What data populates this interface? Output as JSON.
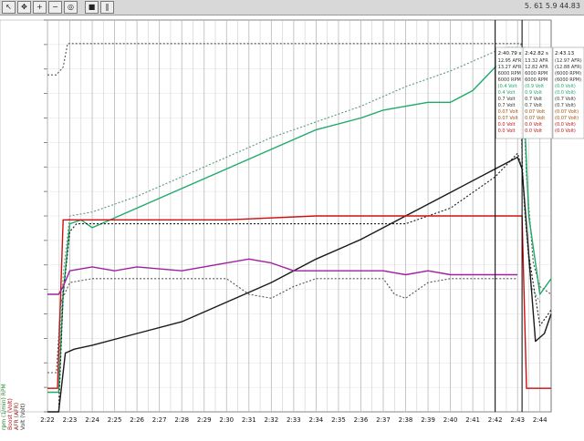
{
  "toolbar": {
    "buttons": [
      {
        "icon": "cursor-icon",
        "glyph": "↖"
      },
      {
        "icon": "move-icon",
        "glyph": "✥"
      },
      {
        "icon": "zoom-in-icon",
        "glyph": "+"
      },
      {
        "icon": "zoom-out-icon",
        "glyph": "−"
      },
      {
        "icon": "zoom-fit-icon",
        "glyph": "◎"
      },
      {
        "icon": "stop-icon",
        "glyph": "■"
      },
      {
        "icon": "pause-icon",
        "glyph": "‖"
      }
    ],
    "status": "5. 61 5.9 44.83"
  },
  "colors": {
    "background": "#ffffff",
    "grid": "#b8b8b8",
    "cursor": "#000000",
    "afr_solid": "#1faa6a",
    "afr_dotted": "#5a9a7a",
    "rpm_solid": "#1a1a1a",
    "rpm_dotted": "#1a1a1a",
    "boost": "#d01010",
    "knock": "#a020a0",
    "volt_dotted": "#555555",
    "tps": "#555555"
  },
  "chart_data": {
    "type": "line",
    "x_ticks": [
      "2:22",
      "2:23",
      "2:24",
      "2:25",
      "2:26",
      "2:27",
      "2:28",
      "2:29",
      "2:30",
      "2:31",
      "2:32",
      "2:33",
      "2:34",
      "2:35",
      "2:36",
      "2:37",
      "2:38",
      "2:39",
      "2:40",
      "2:41",
      "2:42",
      "2:43",
      "2:44"
    ],
    "xlim": [
      2.22,
      2.445
    ],
    "cursors": [
      2.42,
      2.432
    ],
    "cursor_panels": [
      {
        "time": "2:40.79 s",
        "rows": [
          "12.95 AFR",
          "13.27 AFR",
          "6000 RPM",
          "6000 RPM",
          "(0.4 Volt",
          "0.4 Volt",
          "0.7 Volt",
          "0.7 Volt",
          "0.07 Volt",
          "0.07 Volt",
          "0.0 Volt",
          "0.0 Volt"
        ]
      },
      {
        "time": "2:42.82 s",
        "rows": [
          "13.32 AFR",
          "12.82 AFR",
          "6000 RPM",
          "6000 RPM",
          "(0.9 Volt",
          "0.9 Volt",
          "0.7 Volt",
          "0.7 Volt",
          "0.07 Volt",
          "0.07 Volt",
          "0.0 Volt",
          "0.0 Volt"
        ]
      },
      {
        "time": "2:43.13",
        "rows": [
          "(12.97 AFR)",
          "(12.88 AFR)",
          "(6000 RPM)",
          "(6000 RPM)",
          "(0.0 Volt)",
          "(0.0 Volt)",
          "(0.7 Volt)",
          "(0.7 Volt)",
          "(0.07 Volt)",
          "(0.07 Volt)",
          "(0.0 Volt)",
          "(0.0 Volt)"
        ]
      }
    ],
    "left_axis_labels": [
      "rpm (1/min) RPM",
      "Boost (Volt)",
      "AFR (AFR)",
      "Volt (Volt)"
    ],
    "series": [
      {
        "key": "tps_dotted",
        "style": "dotted",
        "color": "#555555",
        "x": [
          2.22,
          2.224,
          2.227,
          2.229,
          2.4315,
          2.434,
          2.437,
          2.44,
          2.445
        ],
        "y": [
          0.86,
          0.86,
          0.88,
          0.94,
          0.94,
          0.6,
          0.38,
          0.32,
          0.3
        ]
      },
      {
        "key": "afr_solid",
        "style": "solid",
        "color": "#1faa6a",
        "x": [
          2.22,
          2.225,
          2.227,
          2.23,
          2.235,
          2.24,
          2.26,
          2.28,
          2.3,
          2.32,
          2.34,
          2.36,
          2.37,
          2.38,
          2.39,
          2.4,
          2.41,
          2.42,
          2.425,
          2.43,
          2.432,
          2.435,
          2.44,
          2.445
        ],
        "y": [
          0.05,
          0.05,
          0.3,
          0.48,
          0.49,
          0.47,
          0.52,
          0.57,
          0.62,
          0.67,
          0.72,
          0.75,
          0.77,
          0.78,
          0.79,
          0.79,
          0.82,
          0.88,
          0.9,
          0.92,
          0.9,
          0.5,
          0.3,
          0.34
        ]
      },
      {
        "key": "afr_dotted",
        "style": "dotted",
        "color": "#5a9a7a",
        "x": [
          2.22,
          2.225,
          2.227,
          2.23,
          2.24,
          2.26,
          2.28,
          2.3,
          2.32,
          2.34,
          2.36,
          2.38,
          2.4,
          2.42,
          2.425,
          2.43,
          2.433,
          2.436,
          2.44
        ],
        "y": [
          0.1,
          0.1,
          0.35,
          0.5,
          0.51,
          0.55,
          0.6,
          0.65,
          0.7,
          0.74,
          0.78,
          0.83,
          0.87,
          0.92,
          0.93,
          0.93,
          0.52,
          0.32,
          0.28
        ]
      },
      {
        "key": "rpm_solid",
        "style": "solid",
        "color": "#1a1a1a",
        "x": [
          2.22,
          2.225,
          2.228,
          2.232,
          2.24,
          2.26,
          2.28,
          2.3,
          2.32,
          2.34,
          2.36,
          2.38,
          2.4,
          2.42,
          2.43,
          2.432,
          2.435,
          2.438,
          2.442,
          2.445
        ],
        "y": [
          0.0,
          0.0,
          0.15,
          0.16,
          0.17,
          0.2,
          0.23,
          0.28,
          0.33,
          0.39,
          0.44,
          0.5,
          0.56,
          0.62,
          0.65,
          0.62,
          0.4,
          0.18,
          0.2,
          0.25
        ]
      },
      {
        "key": "rpm_dotted",
        "style": "dotted",
        "color": "#1a1a1a",
        "x": [
          2.22,
          2.225,
          2.227,
          2.23,
          2.233,
          2.26,
          2.3,
          2.34,
          2.38,
          2.4,
          2.42,
          2.43,
          2.432,
          2.435,
          2.44,
          2.445
        ],
        "y": [
          0.0,
          0.0,
          0.3,
          0.46,
          0.48,
          0.48,
          0.48,
          0.48,
          0.48,
          0.52,
          0.6,
          0.66,
          0.62,
          0.4,
          0.22,
          0.26
        ]
      },
      {
        "key": "boost",
        "style": "solid",
        "color": "#d01010",
        "x": [
          2.22,
          2.2245,
          2.227,
          2.23,
          2.26,
          2.3,
          2.34,
          2.38,
          2.42,
          2.432,
          2.434,
          2.445
        ],
        "y": [
          0.06,
          0.06,
          0.49,
          0.49,
          0.49,
          0.49,
          0.5,
          0.5,
          0.5,
          0.5,
          0.06,
          0.06
        ]
      },
      {
        "key": "knock",
        "style": "solid",
        "color": "#a020a0",
        "x": [
          2.22,
          2.225,
          2.227,
          2.23,
          2.24,
          2.25,
          2.26,
          2.28,
          2.3,
          2.31,
          2.32,
          2.33,
          2.35,
          2.37,
          2.38,
          2.39,
          2.4,
          2.42,
          2.43
        ],
        "y": [
          0.3,
          0.3,
          0.32,
          0.36,
          0.37,
          0.36,
          0.37,
          0.36,
          0.38,
          0.39,
          0.38,
          0.36,
          0.36,
          0.36,
          0.35,
          0.36,
          0.35,
          0.35,
          0.35
        ]
      },
      {
        "key": "volt_dotted",
        "style": "dotted",
        "color": "#555555",
        "x": [
          2.22,
          2.224,
          2.226,
          2.23,
          2.24,
          2.26,
          2.28,
          2.3,
          2.31,
          2.32,
          2.33,
          2.34,
          2.36,
          2.37,
          2.375,
          2.38,
          2.39,
          2.4,
          2.42,
          2.43
        ],
        "y": [
          0.1,
          0.1,
          0.28,
          0.33,
          0.34,
          0.34,
          0.34,
          0.34,
          0.3,
          0.29,
          0.32,
          0.34,
          0.34,
          0.34,
          0.3,
          0.29,
          0.33,
          0.34,
          0.34,
          0.34
        ]
      }
    ]
  }
}
